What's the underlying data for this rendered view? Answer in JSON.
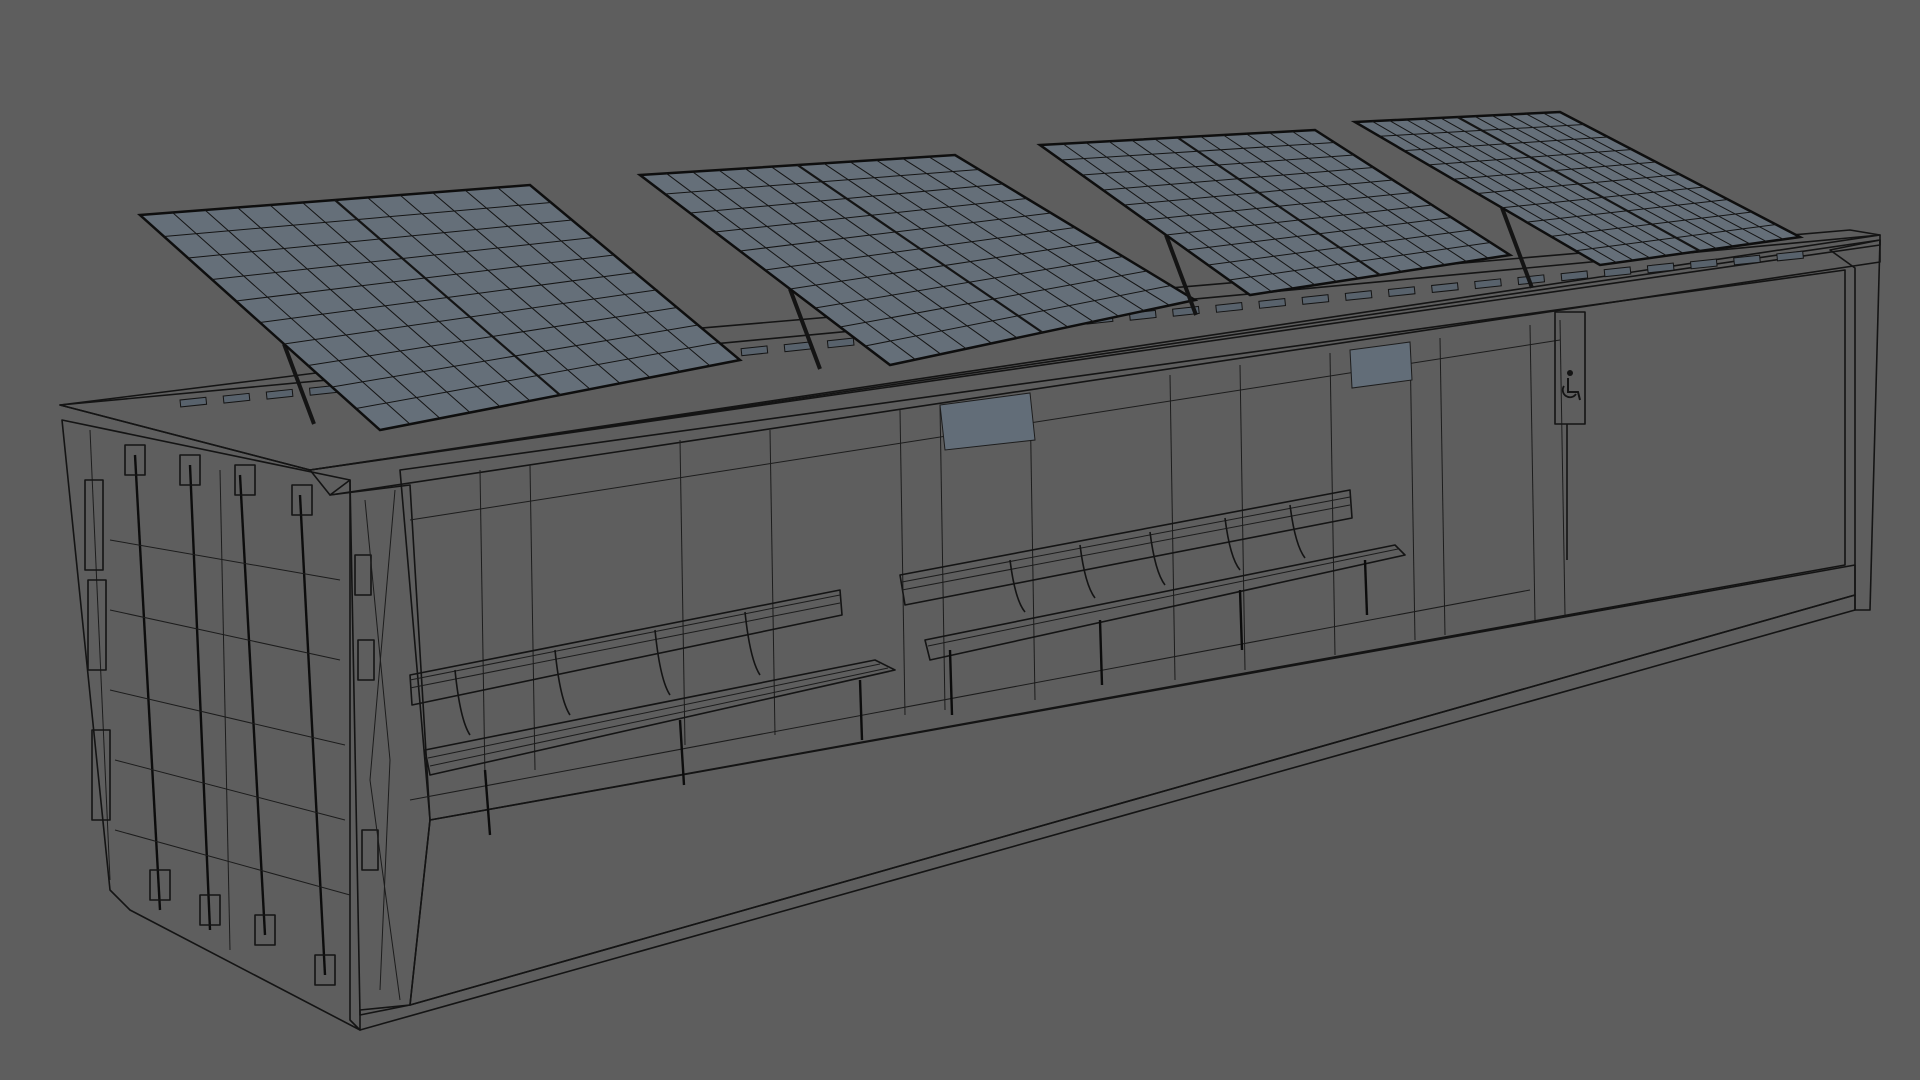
{
  "scene": {
    "background": "#5e5e5e",
    "surface": "#66717c",
    "surface_dark": "#59636d",
    "surface_light": "#737e89",
    "wire": "#141414",
    "panel_count": 4,
    "bench_count": 2,
    "sign_icon": "wheelchair-accessibility-icon"
  }
}
